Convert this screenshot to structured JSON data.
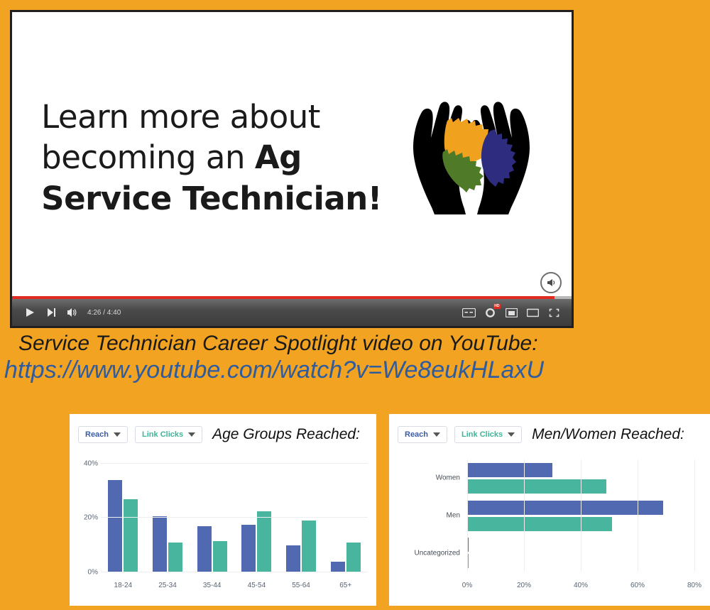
{
  "background_color": "#F2A322",
  "video": {
    "slide": {
      "line1": "Learn more about",
      "line2_plain": "becoming an ",
      "line2_bold": "Ag",
      "line3": "Service Technician!",
      "logo_name": "hands-cradling-gears-logo",
      "logo_colors": {
        "hands": "#000000",
        "gear_top": "#F0A11E",
        "gear_right": "#2E2C7F",
        "gear_left": "#4F7A28"
      }
    },
    "controls": {
      "play_label": "play-button",
      "next_label": "next-video-button",
      "volume_label": "volume-button",
      "time_current": "4:26",
      "time_separator": " / ",
      "time_total": "4:40",
      "time_display": "4:26 / 4:40",
      "captions_label": "CC",
      "settings_badge": "HD",
      "miniplayer_label": "miniplayer-button",
      "theater_label": "theater-mode-button",
      "fullscreen_label": "fullscreen-button",
      "progress_percent": 97,
      "progress_color": "#E22B20"
    },
    "unmute_label": "unmute-button"
  },
  "caption": {
    "line": "Service Technician Career Spotlight video on YouTube:",
    "url": "https://www.youtube.com/watch?v=We8eukHLaxU",
    "url_color": "#2E5C9E"
  },
  "charts": {
    "left": {
      "title": "Age Groups Reached:",
      "buttons": [
        {
          "label": "Reach",
          "color": "#3b5ca8"
        },
        {
          "label": "Link Clicks",
          "color": "#3fb598"
        }
      ]
    },
    "right": {
      "title": "Men/Women Reached:",
      "buttons": [
        {
          "label": "Reach",
          "color": "#3b5ca8"
        },
        {
          "label": "Link Clicks",
          "color": "#3fb598"
        }
      ]
    }
  },
  "chart_data": [
    {
      "type": "bar",
      "orientation": "vertical",
      "title": "Age Groups Reached:",
      "xlabel": "",
      "ylabel": "",
      "categories": [
        "18-24",
        "25-34",
        "35-44",
        "45-54",
        "55-64",
        "65+"
      ],
      "ytick_labels": [
        "0%",
        "20%",
        "40%"
      ],
      "yticks": [
        0,
        20,
        40
      ],
      "ylim": [
        0,
        42
      ],
      "grid": true,
      "legend": "buttons",
      "series": [
        {
          "name": "Reach",
          "color": "#5069B0",
          "values": [
            34,
            20.5,
            17,
            17.5,
            10,
            4
          ]
        },
        {
          "name": "Link Clicks",
          "color": "#48B69F",
          "values": [
            27,
            11,
            11.5,
            22.5,
            19,
            11
          ]
        }
      ]
    },
    {
      "type": "bar",
      "orientation": "horizontal",
      "title": "Men/Women Reached:",
      "xlabel": "",
      "ylabel": "",
      "categories": [
        "Women",
        "Men",
        "Uncategorized"
      ],
      "xtick_labels": [
        "0%",
        "20%",
        "40%",
        "60%",
        "80%"
      ],
      "xticks": [
        0,
        20,
        40,
        60,
        80
      ],
      "xlim": [
        0,
        80
      ],
      "grid": true,
      "legend": "buttons",
      "series": [
        {
          "name": "Reach",
          "color": "#5069B0",
          "values": [
            30,
            69,
            0.5
          ]
        },
        {
          "name": "Link Clicks",
          "color": "#48B69F",
          "values": [
            49,
            51,
            0.5
          ]
        }
      ]
    }
  ]
}
